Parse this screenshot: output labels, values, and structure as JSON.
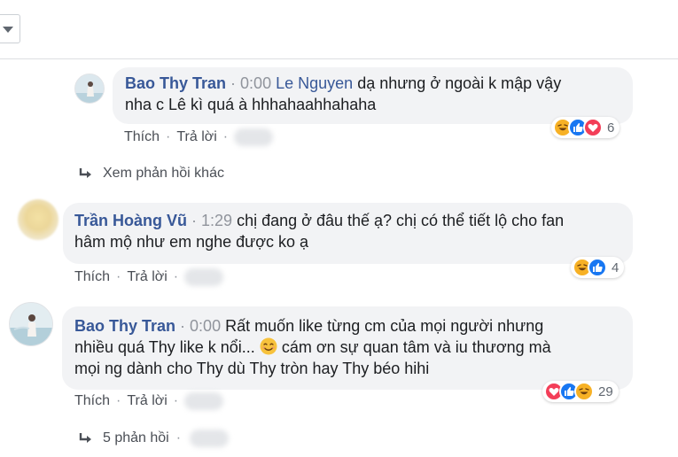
{
  "colors": {
    "author": "#385898",
    "timestamp": "#90949c",
    "bubble_bg": "#f2f3f5",
    "link_text": "#4b4f56",
    "like_blue": "#1877f2",
    "haha_yellow": "#f7b125",
    "love_red": "#f33e58"
  },
  "comments": [
    {
      "author": "Bao Thy Tran",
      "timestamp": "0:00",
      "mention": "Le Nguyen",
      "text_line1": "dạ nhưng ở ngoài k mập vậy",
      "text_line2": "nha c Lê kì quá à hhhahaahhahaha",
      "like_label": "Thích",
      "reply_label": "Trả lời",
      "reactions": [
        "haha",
        "like",
        "love"
      ],
      "reaction_count": "6"
    },
    {
      "author": "Trần Hoàng Vũ",
      "timestamp": "1:29",
      "text_line1": "chị đang ở đâu thế ạ? chị có thể tiết lộ cho fan",
      "text_line2": "hâm mộ như em nghe được ko ạ",
      "like_label": "Thích",
      "reply_label": "Trả lời",
      "reactions": [
        "haha",
        "like"
      ],
      "reaction_count": "4"
    },
    {
      "author": "Bao Thy Tran",
      "timestamp": "0:00",
      "text_line1": "Rất muốn like từng cm của mọi người nhưng",
      "text_line2a": "nhiều quá Thy like k nổi...",
      "text_line2b": "cám ơn sự quan tâm và iu thương mà",
      "text_line3": "mọi ng dành cho Thy dù Thy tròn hay Thy béo hihi",
      "inline_emoji": "smiling-face",
      "like_label": "Thích",
      "reply_label": "Trả lời",
      "reactions": [
        "love",
        "like",
        "haha"
      ],
      "reaction_count": "29"
    }
  ],
  "more_replies_label": "Xem phản hồi khác",
  "replies_count_label": "5 phản hồi"
}
